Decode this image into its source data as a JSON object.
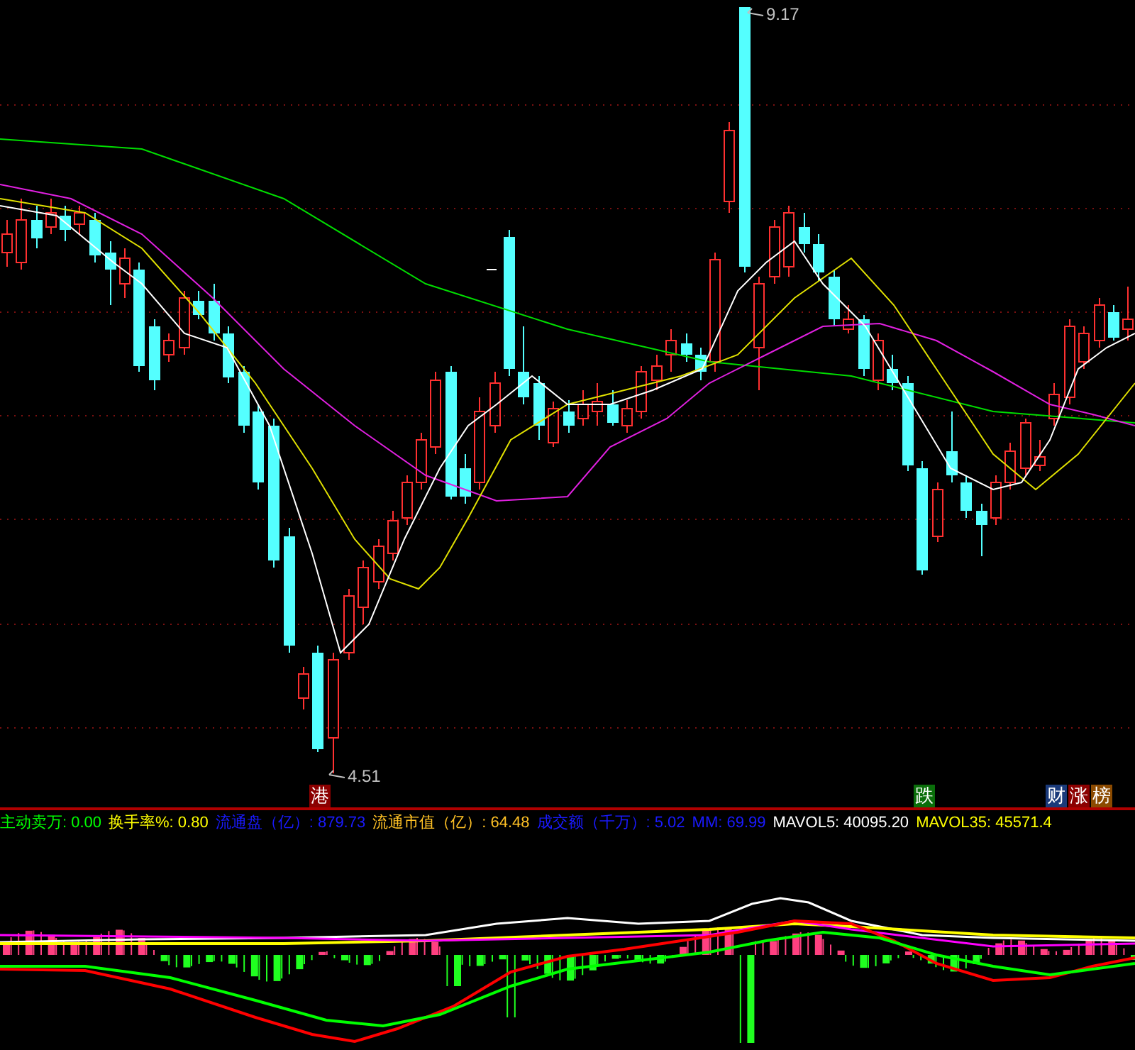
{
  "price_labels": [
    {
      "kind": "high",
      "text": "9.17"
    },
    {
      "kind": "low",
      "text": "4.51"
    }
  ],
  "event_badges": [
    {
      "text": "港",
      "color": "#8b0000"
    },
    {
      "text": "跌",
      "color": "#0a6e0a"
    },
    {
      "text": "财",
      "color": "#1a3a7a"
    },
    {
      "text": "涨",
      "color": "#8b0000"
    },
    {
      "text": "榜",
      "color": "#8b4a00"
    }
  ],
  "indicators": [
    {
      "text": "主动卖万: 0.00",
      "color": "#00ff00"
    },
    {
      "text": "换手率%: 0.80",
      "color": "#ffff00"
    },
    {
      "text": "流通盘（亿）: 879.73",
      "color": "#1a1aff"
    },
    {
      "text": "流通市值（亿）: 64.48",
      "color": "#ffc125"
    },
    {
      "text": "成交额（千万）: 5.02",
      "color": "#1a1aff"
    },
    {
      "text": "MM: 69.99",
      "color": "#1a1aff"
    },
    {
      "text": "MAVOL5: 40095.20",
      "color": "#ffffff"
    },
    {
      "text": "MAVOL35: 45571.4",
      "color": "#ffff00"
    }
  ]
}
